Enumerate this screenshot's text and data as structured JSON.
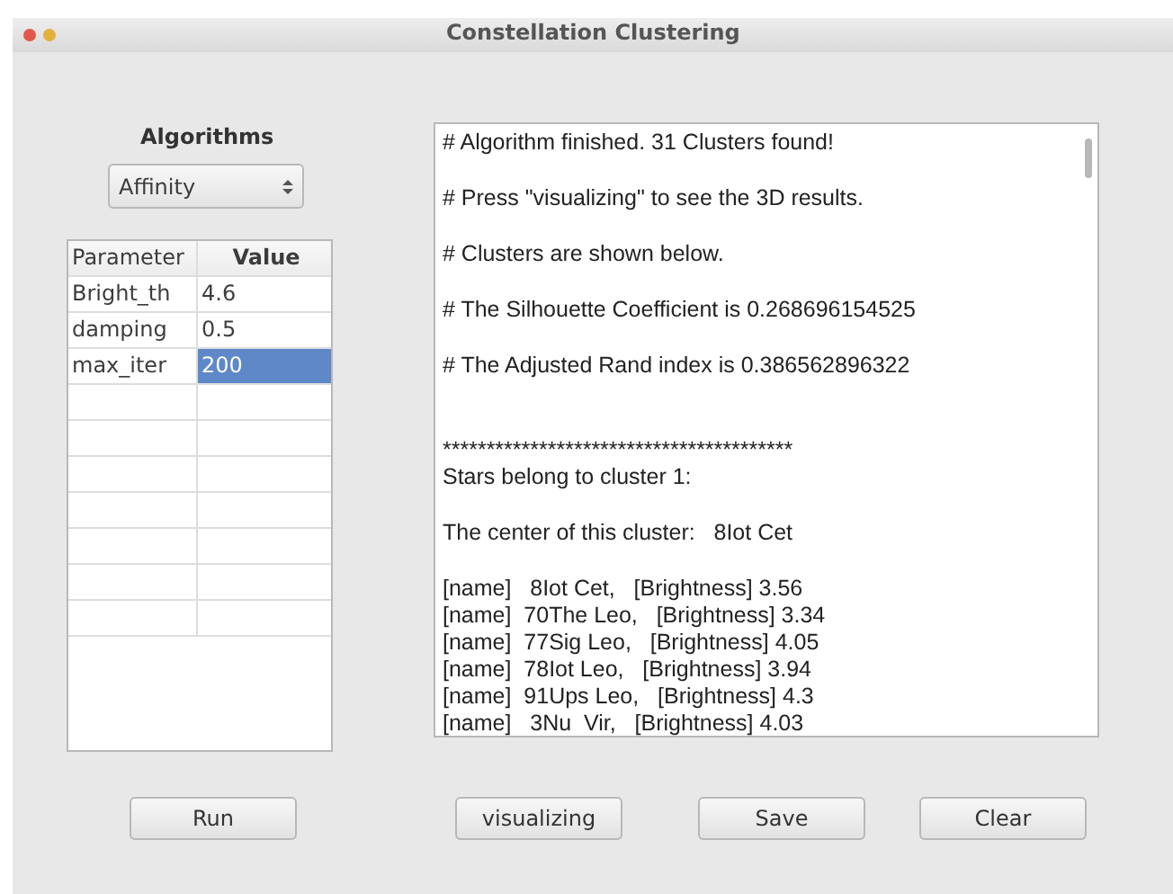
{
  "window": {
    "title": "Constellation Clustering"
  },
  "algorithms": {
    "label": "Algorithms",
    "value": "Affinity"
  },
  "table": {
    "columns": [
      "Parameter",
      "Value"
    ],
    "rows": [
      {
        "name": "Bright_th",
        "value": "4.6",
        "selected": false
      },
      {
        "name": "damping",
        "value": "0.5",
        "selected": false
      },
      {
        "name": "max_iter",
        "value": "200",
        "selected": true
      }
    ]
  },
  "output": [
    {
      "kind": "para",
      "text": "# Algorithm finished. 31 Clusters found!"
    },
    {
      "kind": "para",
      "text": "# Press \"visualizing\" to see the 3D results."
    },
    {
      "kind": "para",
      "text": "# Clusters are shown below."
    },
    {
      "kind": "para",
      "text": "# The Silhouette Coefficient is 0.268696154525"
    },
    {
      "kind": "section_end",
      "text": "# The Adjusted Rand index is 0.386562896322"
    },
    {
      "kind": "line",
      "text": "****************************************"
    },
    {
      "kind": "para",
      "text": "Stars belong to cluster 1:"
    },
    {
      "kind": "para",
      "text": "The center of this cluster:   8Iot Cet"
    },
    {
      "kind": "line",
      "text": "[name]   8Iot Cet,   [Brightness] 3.56"
    },
    {
      "kind": "line",
      "text": "[name]  70The Leo,   [Brightness] 3.34"
    },
    {
      "kind": "line",
      "text": "[name]  77Sig Leo,   [Brightness] 4.05"
    },
    {
      "kind": "line",
      "text": "[name]  78Iot Leo,   [Brightness] 3.94"
    },
    {
      "kind": "line",
      "text": "[name]  91Ups Leo,   [Brightness] 4.3"
    },
    {
      "kind": "line",
      "text": "[name]   3Nu  Vir,   [Brightness] 4.03"
    }
  ],
  "buttons": {
    "run": "Run",
    "actions": [
      "visualizing",
      "Save",
      "Clear"
    ]
  }
}
